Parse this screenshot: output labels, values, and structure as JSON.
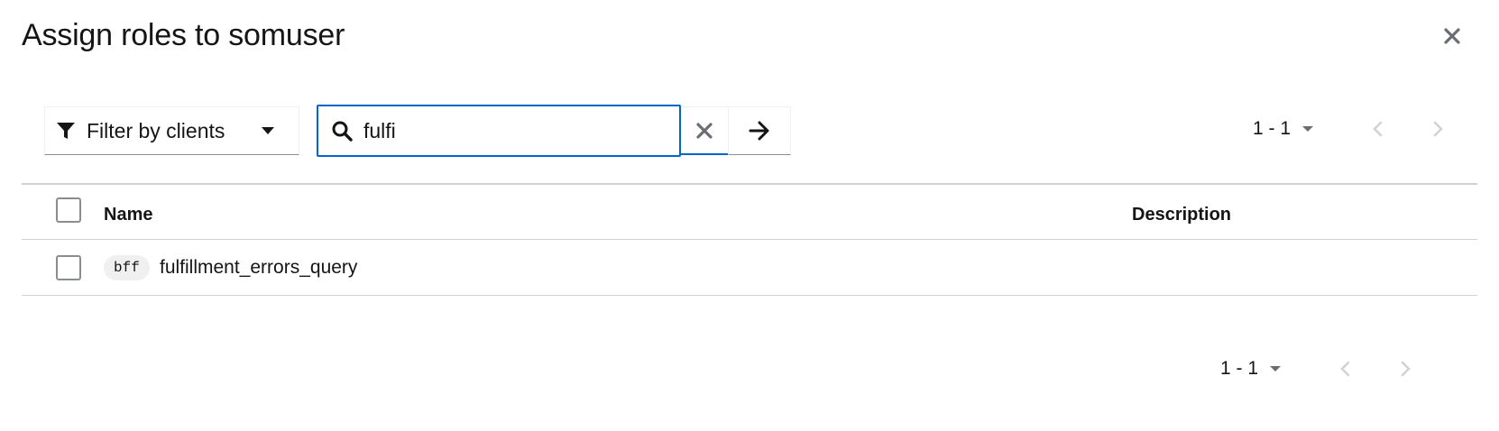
{
  "modal": {
    "title": "Assign roles to somuser"
  },
  "toolbar": {
    "filter_label": "Filter by clients",
    "search_value": "fulfi",
    "pagination_range": "1 - 1"
  },
  "table": {
    "columns": [
      "Name",
      "Description"
    ],
    "rows": [
      {
        "badge": "bff",
        "name": "fulfillment_errors_query",
        "description": ""
      }
    ]
  },
  "footer": {
    "pagination_range": "1 - 1"
  },
  "colors": {
    "accent": "#0066cc",
    "text": "#151515",
    "border": "#d2d2d2",
    "disabled_icon": "#d2d2d2",
    "icon": "#6a6e73"
  },
  "icons": [
    "close-icon",
    "filter-icon",
    "caret-down-icon",
    "search-icon",
    "clear-icon",
    "arrow-right-icon",
    "chevron-left-icon",
    "chevron-right-icon"
  ]
}
